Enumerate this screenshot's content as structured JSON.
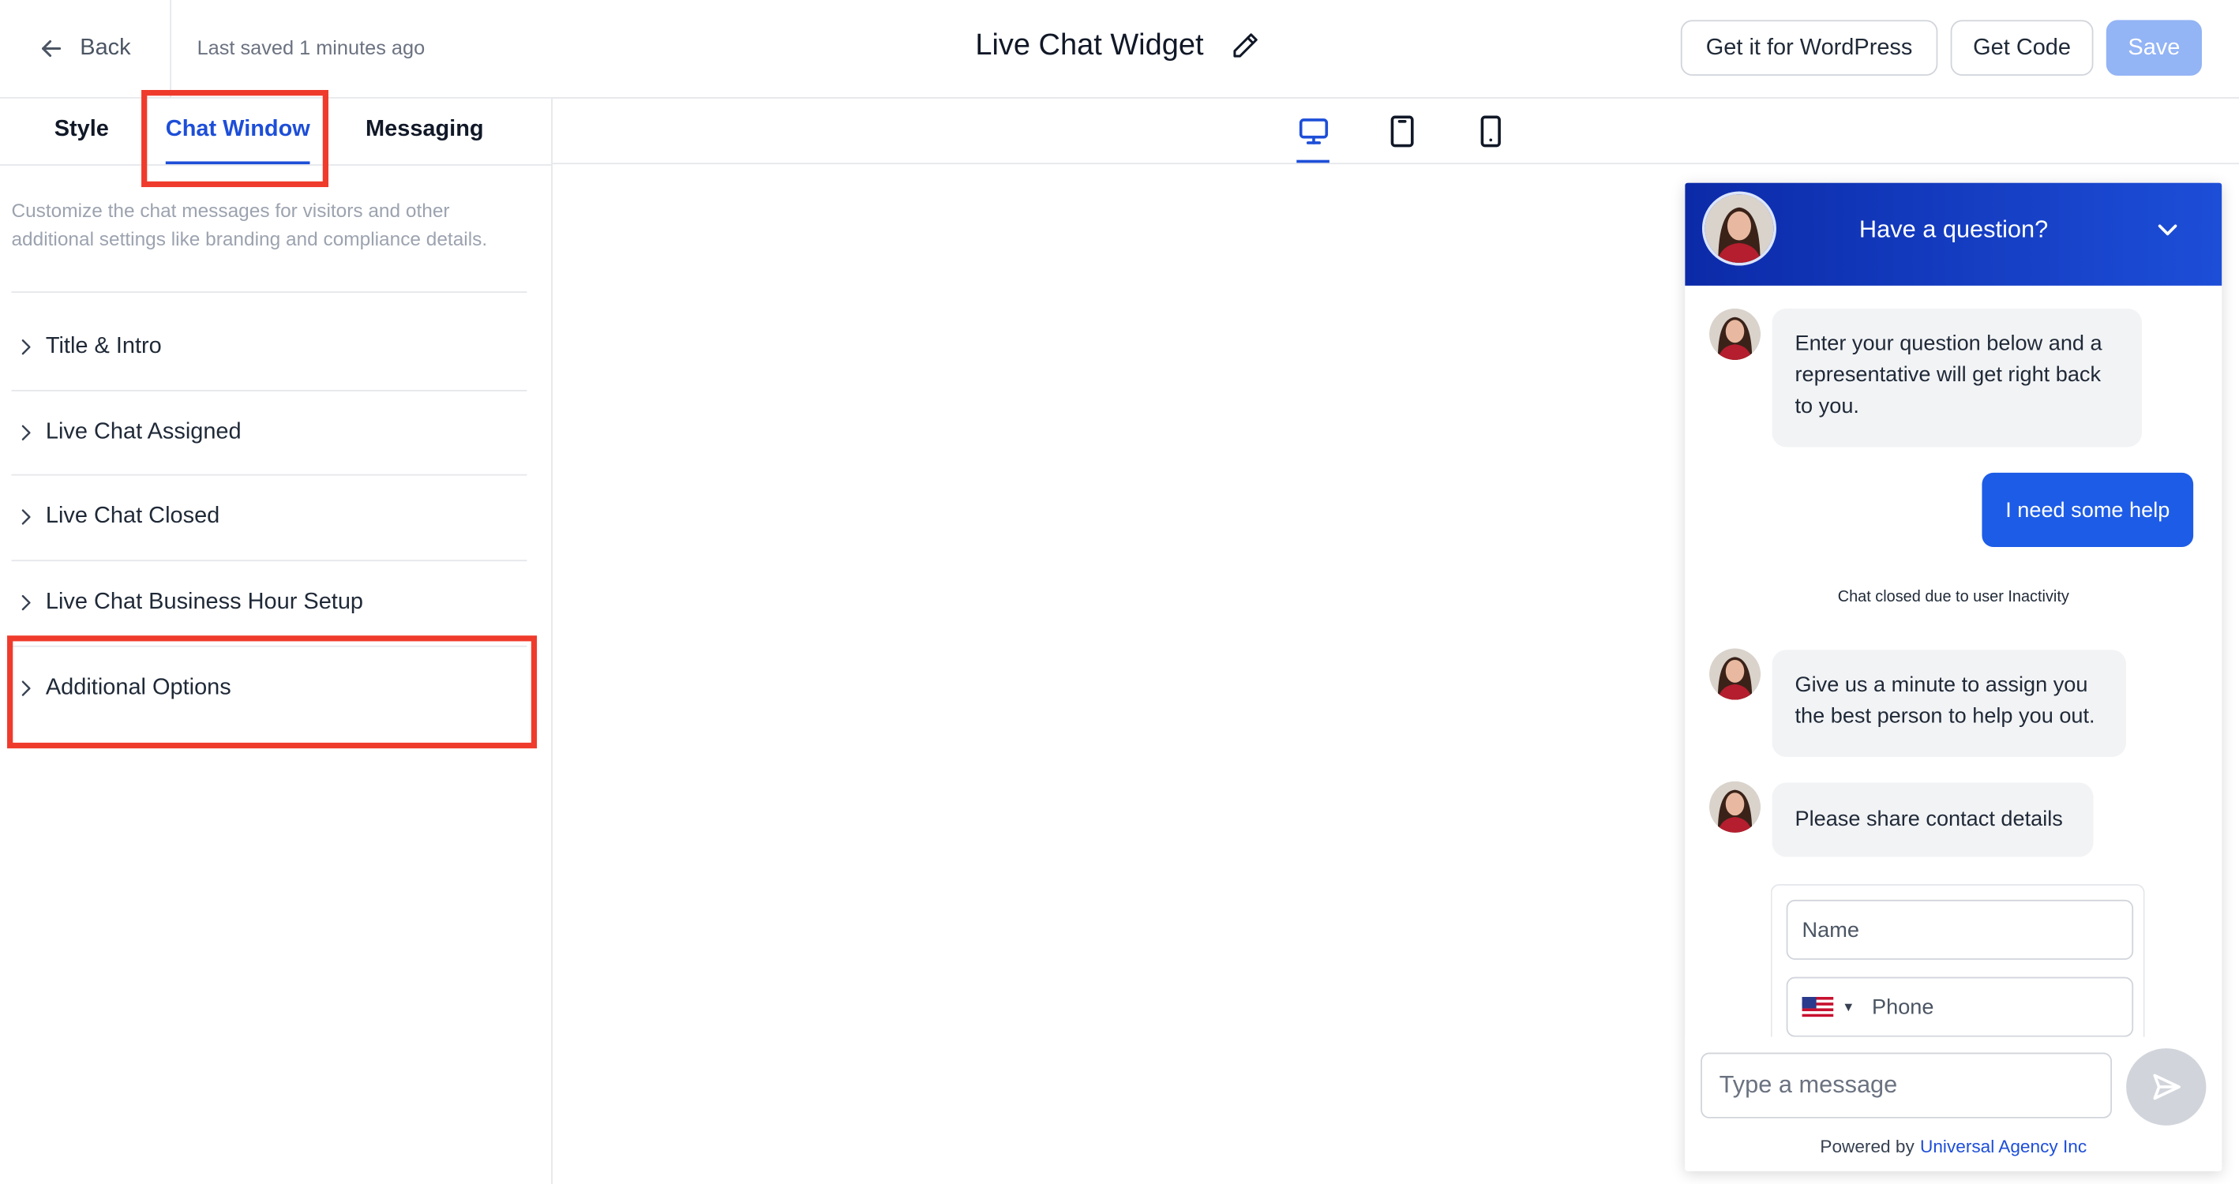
{
  "header": {
    "back_label": "Back",
    "last_saved": "Last saved 1 minutes ago",
    "title": "Live Chat Widget",
    "wordpress_button": "Get it for WordPress",
    "get_code_button": "Get Code",
    "save_button": "Save"
  },
  "sidebar": {
    "tabs": [
      "Style",
      "Chat Window",
      "Messaging"
    ],
    "active_tab": "Chat Window",
    "description": "Customize the chat messages for visitors and other additional settings like branding and compliance details.",
    "sections": [
      "Title & Intro",
      "Live Chat Assigned",
      "Live Chat Closed",
      "Live Chat Business Hour Setup",
      "Additional Options"
    ]
  },
  "preview": {
    "devices": [
      "desktop-icon",
      "tablet-icon",
      "mobile-icon"
    ],
    "active_device": "desktop"
  },
  "widget": {
    "header_title": "Have a question?",
    "messages": [
      {
        "from": "agent",
        "text": "Enter your question below and a representative will get right back to you."
      },
      {
        "from": "visitor",
        "text": "I need some help"
      },
      {
        "from": "system",
        "text": "Chat closed due to user Inactivity"
      },
      {
        "from": "agent",
        "text": "Give us a minute to assign you the best person to help you out."
      },
      {
        "from": "agent",
        "text": "Please share contact details"
      }
    ],
    "form": {
      "name_placeholder": "Name",
      "phone_placeholder": "Phone"
    },
    "input_placeholder": "Type a message",
    "powered_by": "Powered by",
    "powered_by_link": "Universal Agency Inc"
  },
  "colors": {
    "accent": "#1d4ed8",
    "highlight": "#ef3b2c",
    "save_disabled": "#93b4f5",
    "widget_header": "#0b2aa8"
  }
}
